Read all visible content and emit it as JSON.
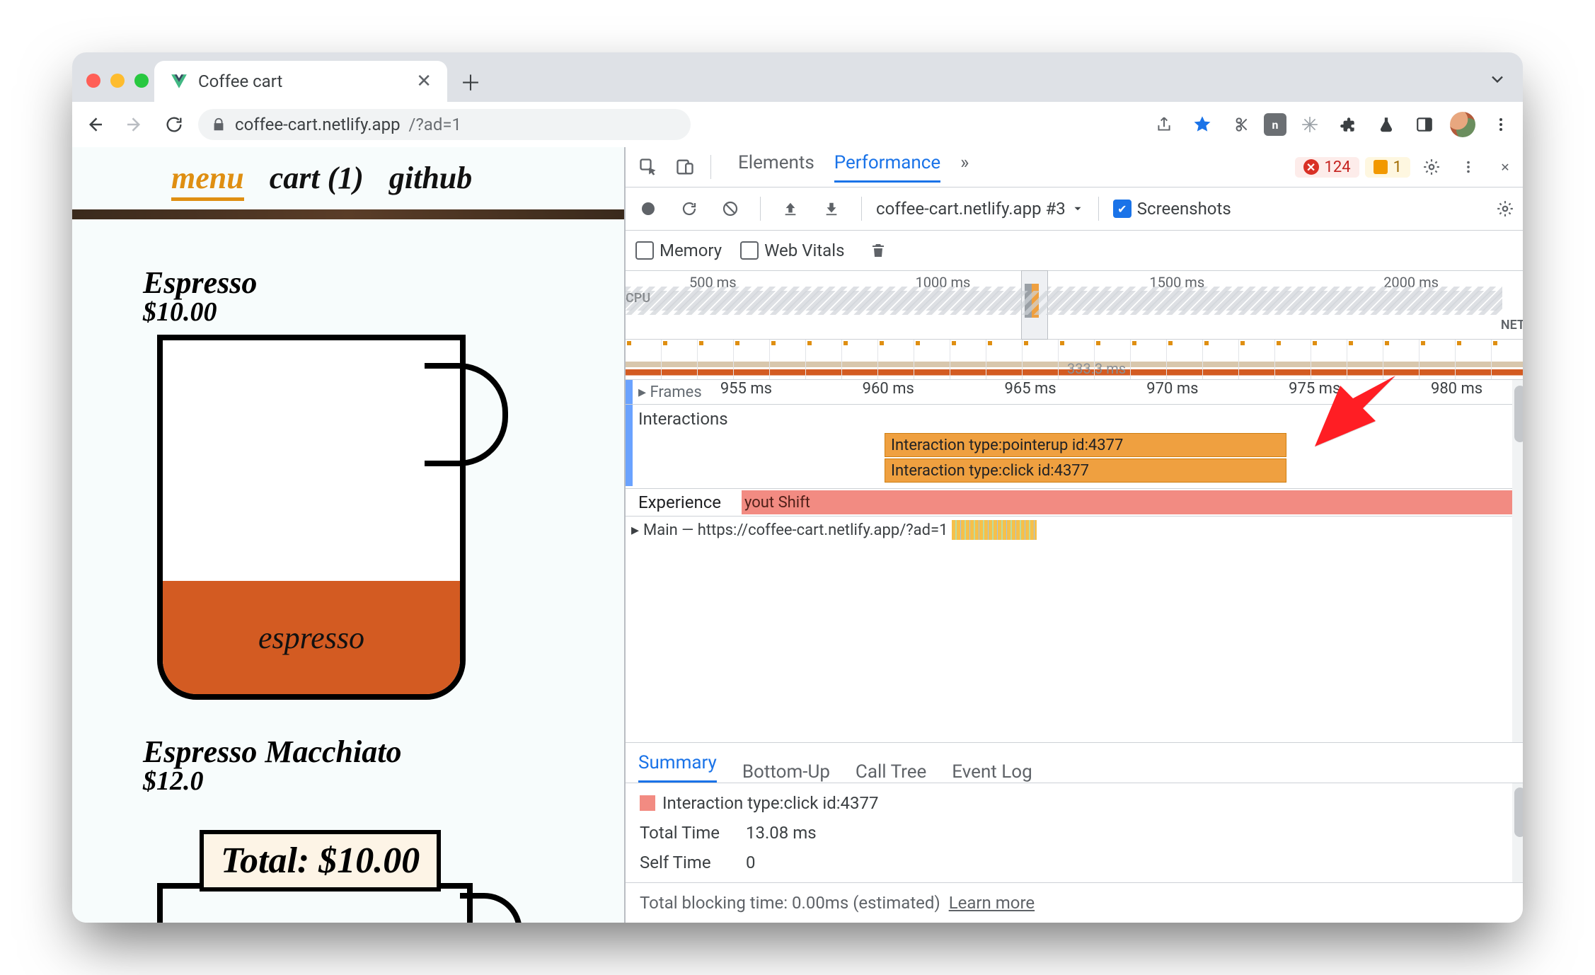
{
  "browser": {
    "tab_title": "Coffee cart",
    "url_host": "coffee-cart.netlify.app",
    "url_path": "/?ad=1"
  },
  "page": {
    "nav": {
      "menu": "menu",
      "cart": "cart (1)",
      "github": "github"
    },
    "product1": {
      "name": "Espresso",
      "price": "$10.00",
      "fill_label": "espresso"
    },
    "product2": {
      "name": "Espresso Macchiato",
      "price": "$12.0"
    },
    "total_label": "Total: $10.00"
  },
  "devtools": {
    "tabs": {
      "elements": "Elements",
      "performance": "Performance",
      "more": "»"
    },
    "errors": "124",
    "issues": "1",
    "toolbar": {
      "recording_name": "coffee-cart.netlify.app #3",
      "screenshots": "Screenshots",
      "memory": "Memory",
      "webvitals": "Web Vitals"
    },
    "overview": {
      "ticks": [
        "500 ms",
        "1000 ms",
        "1500 ms",
        "2000 ms"
      ],
      "cpu": "CPU",
      "net": "NET"
    },
    "flame": {
      "frames_label": "Frames",
      "ruler": [
        "955 ms",
        "960 ms",
        "965 ms",
        "970 ms",
        "975 ms",
        "980 ms"
      ],
      "fps": "333.3 ms",
      "interactions_label": "Interactions",
      "bar1": "Interaction type:pointerup id:4377",
      "bar2": "Interaction type:click id:4377",
      "experience_label": "Experience",
      "shift_text": "yout Shift",
      "main_label": "Main — https://coffee-cart.netlify.app/?ad=1"
    },
    "summary_tabs": {
      "summary": "Summary",
      "bottomup": "Bottom-Up",
      "calltree": "Call Tree",
      "eventlog": "Event Log"
    },
    "summary": {
      "title": "Interaction type:click id:4377",
      "total_k": "Total Time",
      "total_v": "13.08 ms",
      "self_k": "Self Time",
      "self_v": "0"
    },
    "footer": {
      "tbt": "Total blocking time: 0.00ms (estimated)",
      "learn": "Learn more"
    }
  }
}
